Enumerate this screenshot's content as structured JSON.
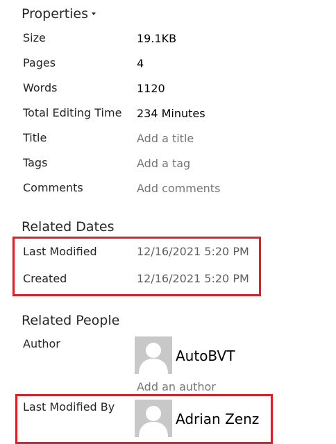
{
  "properties": {
    "title": "Properties",
    "rows": [
      {
        "label": "Size",
        "value": "19.1KB"
      },
      {
        "label": "Pages",
        "value": "4"
      },
      {
        "label": "Words",
        "value": "1120"
      },
      {
        "label": "Total Editing Time",
        "value": "234 Minutes"
      },
      {
        "label": "Title",
        "value": "Add a title"
      },
      {
        "label": "Tags",
        "value": "Add a tag"
      },
      {
        "label": "Comments",
        "value": "Add comments"
      }
    ]
  },
  "related_dates": {
    "title": "Related Dates",
    "rows": [
      {
        "label": "Last Modified",
        "value": "12/16/2021 5:20 PM"
      },
      {
        "label": "Created",
        "value": "12/16/2021 5:20 PM"
      }
    ]
  },
  "related_people": {
    "title": "Related People",
    "author_label": "Author",
    "author_name": "AutoBVT",
    "add_author": "Add an author",
    "last_modified_by_label": "Last Modified By",
    "last_modified_by_name": "Adrian Zenz"
  },
  "colors": {
    "highlight": "#e01e26",
    "avatar_bg": "#c8c8c8",
    "placeholder_text": "#767676"
  }
}
